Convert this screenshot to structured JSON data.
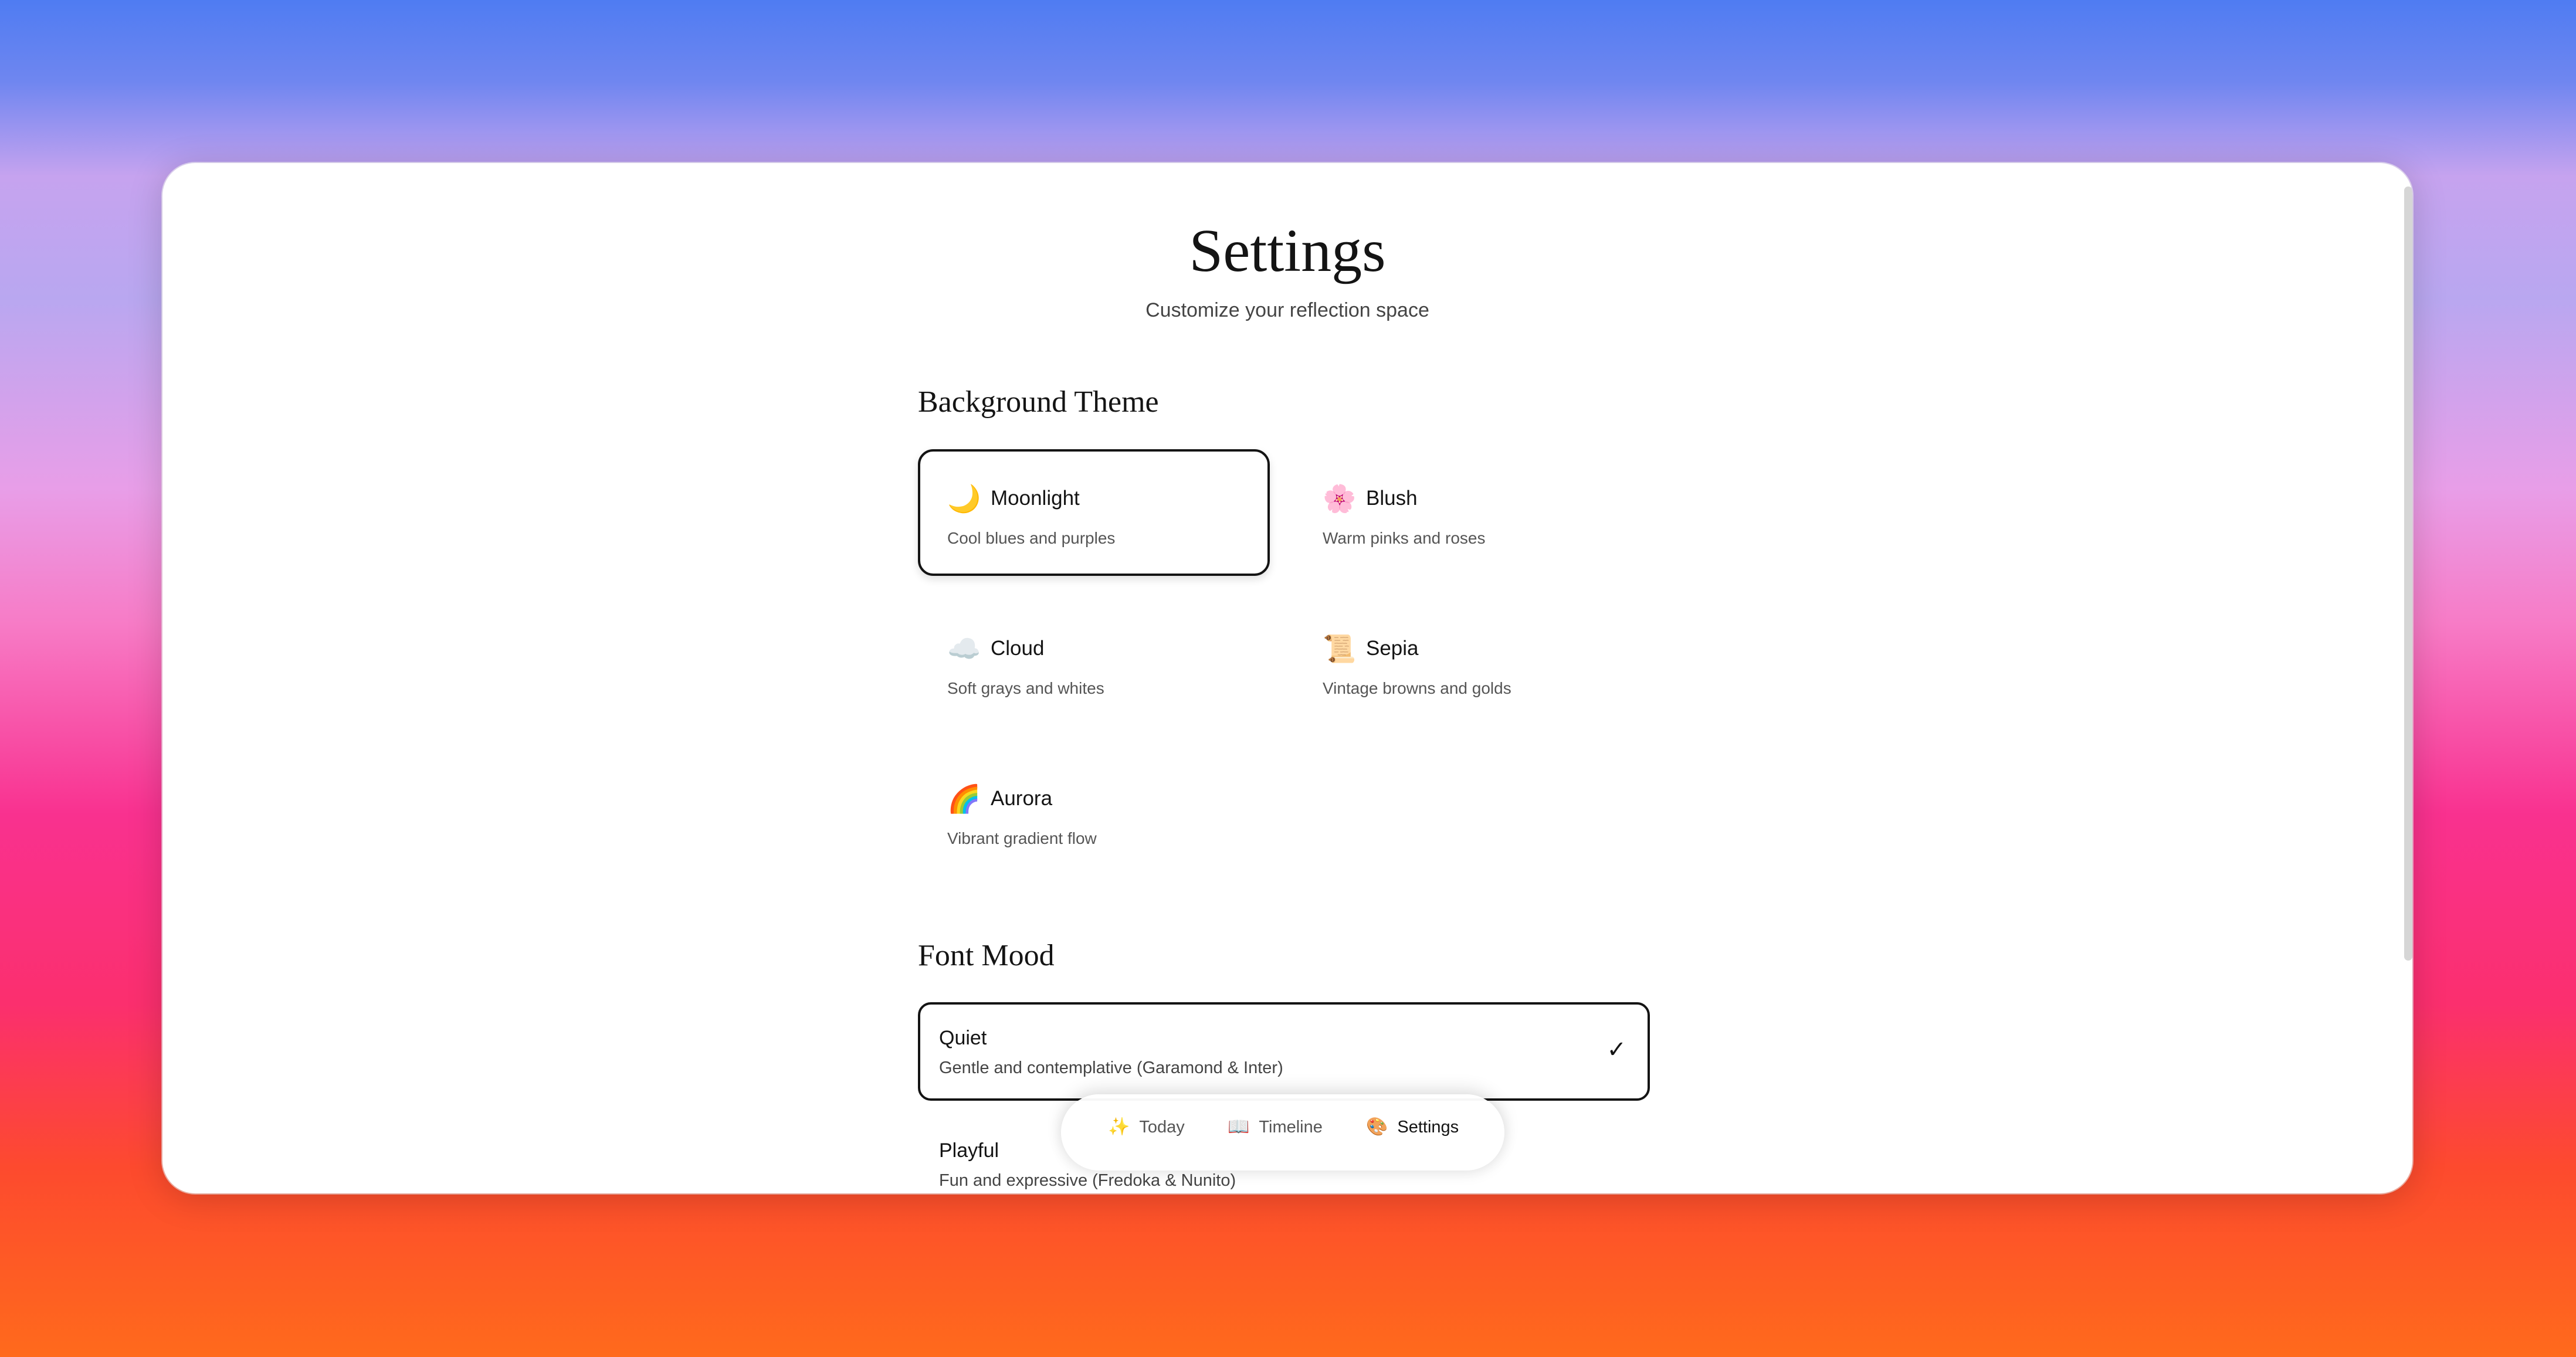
{
  "page": {
    "title": "Settings",
    "subtitle": "Customize your reflection space"
  },
  "background_theme": {
    "heading": "Background Theme",
    "selected": "Moonlight",
    "options": [
      {
        "icon": "crescent-moon-icon",
        "glyph": "🌙",
        "name": "Moonlight",
        "desc": "Cool blues and purples"
      },
      {
        "icon": "blossom-icon",
        "glyph": "🌸",
        "name": "Blush",
        "desc": "Warm pinks and roses"
      },
      {
        "icon": "cloud-icon",
        "glyph": "☁️",
        "name": "Cloud",
        "desc": "Soft grays and whites"
      },
      {
        "icon": "scroll-icon",
        "glyph": "📜",
        "name": "Sepia",
        "desc": "Vintage browns and golds"
      },
      {
        "icon": "rainbow-icon",
        "glyph": "🌈",
        "name": "Aurora",
        "desc": "Vibrant gradient flow"
      }
    ]
  },
  "font_mood": {
    "heading": "Font Mood",
    "selected": "Quiet",
    "check": "✓",
    "options": [
      {
        "name": "Quiet",
        "desc": "Gentle and contemplative (Garamond & Inter)"
      },
      {
        "name": "Playful",
        "desc": "Fun and expressive (Fredoka & Nunito)"
      }
    ]
  },
  "nav": {
    "active": "Settings",
    "items": [
      {
        "icon": "sparkles-icon",
        "glyph": "✨",
        "label": "Today"
      },
      {
        "icon": "open-book-icon",
        "glyph": "📖",
        "label": "Timeline"
      },
      {
        "icon": "palette-icon",
        "glyph": "🎨",
        "label": "Settings"
      }
    ]
  }
}
